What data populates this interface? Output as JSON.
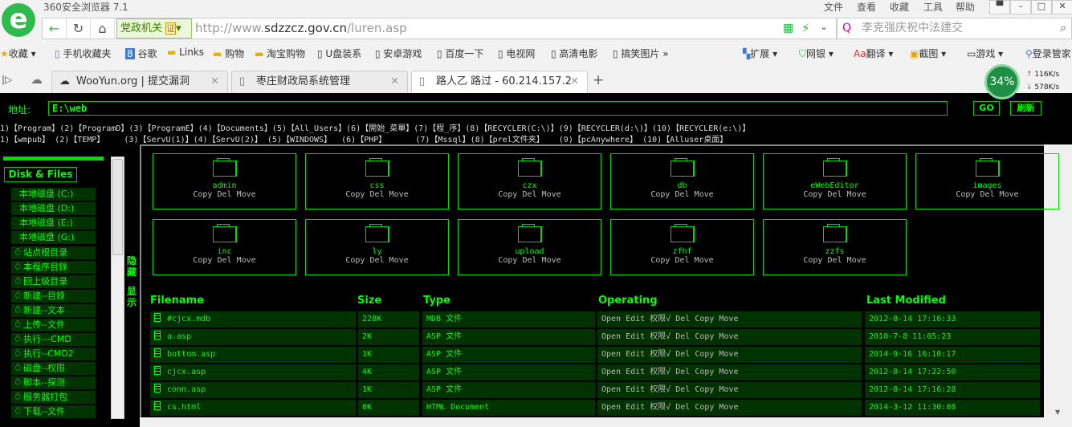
{
  "browser": {
    "title": "360安全浏览器 7.1",
    "menu": [
      "文件",
      "查看",
      "收藏",
      "工具",
      "帮助"
    ],
    "gov_badge": "党政机关",
    "cert_label": "证",
    "url_prefix": "http://www.",
    "url_domain": "sdzzcz.gov.cn",
    "url_path": "/luren.asp",
    "search_placeholder": "李克强庆祝中法建交",
    "bookmarks": [
      "收藏",
      "手机收藏夹",
      "谷歌",
      "Links",
      "购物",
      "淘宝购物",
      "U盘装系",
      "安卓游戏",
      "百度一下",
      "电视网",
      "高清电影",
      "搞笑图片"
    ],
    "tools": [
      "扩展",
      "网银",
      "翻译",
      "截图",
      "游戏",
      "登录管家"
    ],
    "tabs": [
      {
        "label": "WooYun.org | 提交漏洞"
      },
      {
        "label": "枣庄财政局系统管理"
      },
      {
        "label": "路人乙 路过 - 60.214.157.2"
      }
    ],
    "speed_percent": "34%",
    "upload_speed": "116K/s",
    "download_speed": "578K/s"
  },
  "shell": {
    "address_label": "地址:",
    "path_value": "E:\\web",
    "go_label": "GO",
    "refresh_label": "刷新",
    "quick_links_row1": [
      "1)【Program】",
      "(2)【ProgramD】",
      "(3)【ProgramE】",
      "(4)【Documents】",
      "(5)【All_Users】",
      "(6)【開始_菜單】",
      "(7)【程_序】",
      "(8)【RECYCLER(C:\\)】",
      "(9)【RECYCLER(d:\\)】",
      "(10)【RECYCLER(e:\\)】"
    ],
    "quick_links_row2": [
      "1)【wmpub】 ",
      "(2)【TEMP】    ",
      "(3)【ServU(1)】",
      "(4)【ServU(2)】 ",
      "(5)【WINDOWS】  ",
      "(6)【PHP】      ",
      "(7)【Mssql】",
      "(8)【prel文件夹】   ",
      "(9)【pcAnywhere】 ",
      "(10)【Alluser桌面】"
    ],
    "disk_files_label": "Disk & Files",
    "disks": [
      "本地磁盘 (C:)",
      "本地磁盘 (D:)",
      "本地磁盘 (E:)",
      "本地磁盘 (G:)"
    ],
    "side_links": [
      "站点根目录",
      "本程序目錄",
      "回上级目录",
      "新建--目錄",
      "新建--文本",
      "上传--文件",
      "执行---CMD",
      "执行--CMD2",
      "磁盘--权限",
      "脚本--探测",
      "服务器打包",
      "下载--文件"
    ],
    "hide_label": "隐藏",
    "show_label": "显示",
    "folders": [
      "admin",
      "css",
      "czx",
      "db",
      "eWebEditor",
      "images",
      "inc",
      "ly",
      "upload",
      "zfhf",
      "zzfs"
    ],
    "folder_ops": "Copy Del Move",
    "columns": [
      "Filename",
      "Size",
      "Type",
      "Operating",
      "Last Modified"
    ],
    "file_ops": "Open Edit 权限√ Del Copy Move",
    "files": [
      {
        "name": "#cjcx.mdb",
        "size": "228K",
        "type": "MDB 文件",
        "modified": "2012-8-14 17:16:33"
      },
      {
        "name": "a.asp",
        "size": "2K",
        "type": "ASP 文件",
        "modified": "2010-7-8 11:05:23"
      },
      {
        "name": "bottom.asp",
        "size": "1K",
        "type": "ASP 文件",
        "modified": "2014-9-16 16:10:17"
      },
      {
        "name": "cjcx.asp",
        "size": "4K",
        "type": "ASP 文件",
        "modified": "2012-8-14 17:22:50"
      },
      {
        "name": "conn.asp",
        "size": "1K",
        "type": "ASP 文件",
        "modified": "2012-8-14 17:16:28"
      },
      {
        "name": "cs.html",
        "size": "0K",
        "type": "HTML Document",
        "modified": "2014-3-12 11:30:08"
      }
    ]
  }
}
